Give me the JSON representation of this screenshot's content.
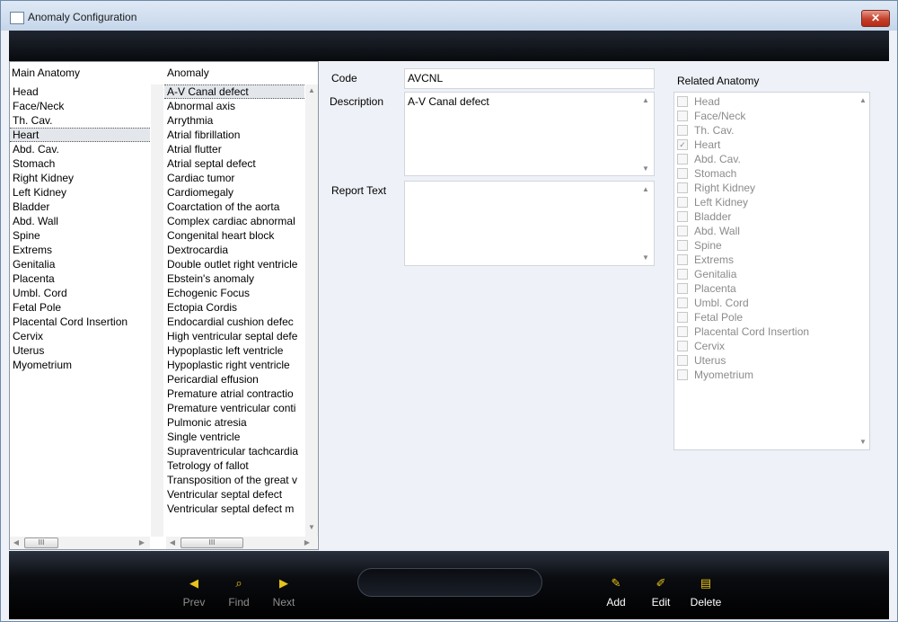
{
  "window": {
    "title": "Anomaly Configuration",
    "close_label": "✕"
  },
  "main_anatomy": {
    "header": "Main Anatomy",
    "items": [
      "Head",
      "Face/Neck",
      "Th. Cav.",
      "Heart",
      "Abd. Cav.",
      "Stomach",
      "Right Kidney",
      "Left Kidney",
      "Bladder",
      "Abd. Wall",
      "Spine",
      "Extrems",
      "Genitalia",
      "Placenta",
      "Umbl. Cord",
      "Fetal Pole",
      "Placental Cord Insertion",
      "Cervix",
      "Uterus",
      "Myometrium"
    ],
    "selected": "Heart"
  },
  "anomaly": {
    "header": "Anomaly",
    "items": [
      "A-V Canal defect",
      "Abnormal axis",
      "Arrythmia",
      "Atrial fibrillation",
      "Atrial flutter",
      "Atrial septal defect",
      "Cardiac tumor",
      "Cardiomegaly",
      "Coarctation of the aorta",
      "Complex cardiac abnormal",
      "Congenital heart block",
      "Dextrocardia",
      "Double outlet right ventricle",
      "Ebstein's anomaly",
      "Echogenic Focus",
      "Ectopia Cordis",
      "Endocardial cushion defec",
      "High ventricular septal defe",
      "Hypoplastic left ventricle",
      "Hypoplastic right ventricle",
      "Pericardial effusion",
      "Premature atrial contractio",
      "Premature ventricular conti",
      "Pulmonic atresia",
      "Single ventricle",
      "Supraventricular tachcardia",
      "Tetrology of fallot",
      "Transposition of the great v",
      "Ventricular septal defect",
      "Ventricular septal defect m"
    ],
    "selected": "A-V Canal defect"
  },
  "form": {
    "code_label": "Code",
    "code_value": "AVCNL",
    "description_label": "Description",
    "description_value": "A-V Canal defect",
    "report_label": "Report Text",
    "report_value": ""
  },
  "related_anatomy": {
    "header": "Related Anatomy",
    "items": [
      {
        "label": "Head",
        "checked": false
      },
      {
        "label": "Face/Neck",
        "checked": false
      },
      {
        "label": "Th. Cav.",
        "checked": false
      },
      {
        "label": "Heart",
        "checked": true
      },
      {
        "label": "Abd. Cav.",
        "checked": false
      },
      {
        "label": "Stomach",
        "checked": false
      },
      {
        "label": "Right Kidney",
        "checked": false
      },
      {
        "label": "Left Kidney",
        "checked": false
      },
      {
        "label": "Bladder",
        "checked": false
      },
      {
        "label": "Abd. Wall",
        "checked": false
      },
      {
        "label": "Spine",
        "checked": false
      },
      {
        "label": "Extrems",
        "checked": false
      },
      {
        "label": "Genitalia",
        "checked": false
      },
      {
        "label": "Placenta",
        "checked": false
      },
      {
        "label": "Umbl. Cord",
        "checked": false
      },
      {
        "label": "Fetal Pole",
        "checked": false
      },
      {
        "label": "Placental Cord Insertion",
        "checked": false
      },
      {
        "label": "Cervix",
        "checked": false
      },
      {
        "label": "Uterus",
        "checked": false
      },
      {
        "label": "Myometrium",
        "checked": false
      }
    ]
  },
  "toolbar": {
    "prev_label": "Prev",
    "find_label": "Find",
    "next_label": "Next",
    "add_label": "Add",
    "edit_label": "Edit",
    "delete_label": "Delete"
  },
  "scroll": {
    "thumb_label": "III"
  },
  "colors": {
    "accent_icon": "#e7c21b",
    "close": "#c33f2a"
  }
}
